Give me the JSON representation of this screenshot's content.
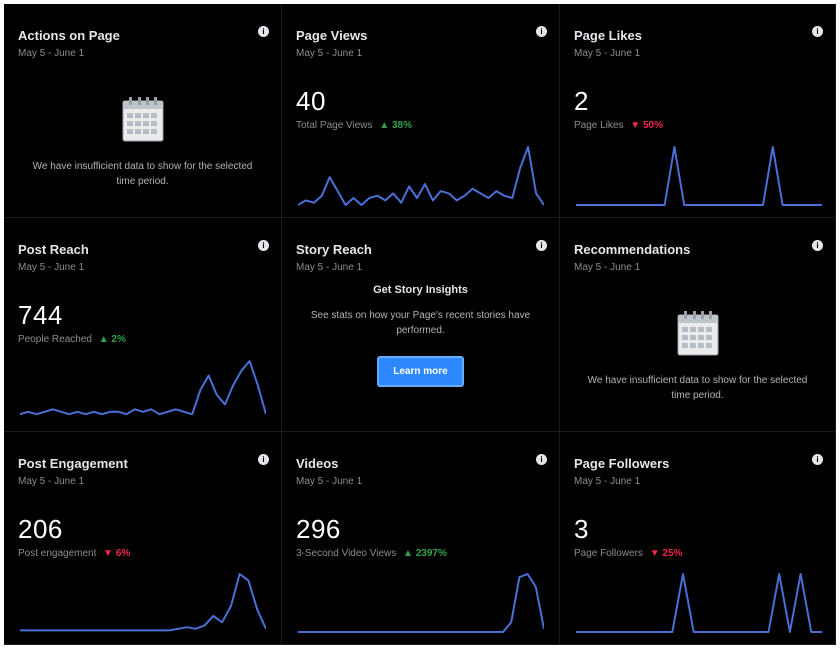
{
  "date_range": "May 5 - June 1",
  "colors": {
    "background": "#000000",
    "line": "#4b6fd6",
    "up": "#31a24c",
    "down": "#f02849",
    "button": "#2d88ff"
  },
  "info_icon": "info-circle-icon",
  "empty_message": "We have insufficient data to show for the selected time period.",
  "cards": {
    "actions_on_page": {
      "title": "Actions on Page",
      "date": "May 5 - June 1"
    },
    "page_views": {
      "title": "Page Views",
      "date": "May 5 - June 1",
      "value": "40",
      "metric_label": "Total Page Views",
      "change": "▲ 38%",
      "trend": "up",
      "series": [
        0,
        2,
        1,
        4,
        12,
        6,
        0,
        3,
        0,
        3,
        4,
        2,
        5,
        1,
        8,
        3,
        9,
        2,
        6,
        5,
        2,
        4,
        7,
        5,
        3,
        6,
        4,
        3,
        16,
        25,
        5,
        0
      ]
    },
    "page_likes": {
      "title": "Page Likes",
      "date": "May 5 - June 1",
      "value": "2",
      "metric_label": "Page Likes",
      "change": "▼ 50%",
      "trend": "down",
      "series": [
        0,
        0,
        0,
        0,
        0,
        0,
        0,
        0,
        0,
        0,
        1,
        0,
        0,
        0,
        0,
        0,
        0,
        0,
        0,
        0,
        1,
        0,
        0,
        0,
        0,
        0
      ]
    },
    "post_reach": {
      "title": "Post Reach",
      "date": "May 5 - June 1",
      "value": "744",
      "metric_label": "People Reached",
      "change": "▲ 2%",
      "trend": "up",
      "series": [
        2,
        3,
        2,
        3,
        4,
        3,
        2,
        3,
        2,
        3,
        2,
        3,
        3,
        2,
        4,
        3,
        4,
        2,
        3,
        4,
        3,
        2,
        12,
        18,
        10,
        6,
        14,
        20,
        24,
        14,
        2
      ]
    },
    "story_reach": {
      "title": "Story Reach",
      "date": "May 5 - June 1",
      "heading": "Get Story Insights",
      "description": "See stats on how your Page's recent stories have performed.",
      "button": "Learn more"
    },
    "recommendations": {
      "title": "Recommendations",
      "date": "May 5 - June 1"
    },
    "post_engagement": {
      "title": "Post Engagement",
      "date": "May 5 - June 1",
      "value": "206",
      "metric_label": "Post engagement",
      "change": "▼ 6%",
      "trend": "down",
      "series": [
        1,
        1,
        1,
        1,
        1,
        1,
        1,
        1,
        1,
        1,
        1,
        1,
        1,
        1,
        1,
        1,
        1,
        1,
        2,
        3,
        2,
        4,
        10,
        6,
        16,
        36,
        32,
        14,
        2
      ]
    },
    "videos": {
      "title": "Videos",
      "date": "May 5 - June 1",
      "value": "296",
      "metric_label": "3-Second Video Views",
      "change": "▲ 2397%",
      "trend": "up",
      "series": [
        0,
        0,
        0,
        0,
        0,
        0,
        0,
        0,
        0,
        0,
        0,
        0,
        0,
        0,
        0,
        0,
        0,
        0,
        0,
        0,
        0,
        0,
        0,
        0,
        0,
        0,
        6,
        34,
        36,
        28,
        2
      ]
    },
    "page_followers": {
      "title": "Page Followers",
      "date": "May 5 - June 1",
      "value": "3",
      "metric_label": "Page Followers",
      "change": "▼ 25%",
      "trend": "down",
      "series": [
        0,
        0,
        0,
        0,
        0,
        0,
        0,
        0,
        0,
        0,
        1,
        0,
        0,
        0,
        0,
        0,
        0,
        0,
        0,
        1,
        0,
        1,
        0,
        0
      ]
    }
  }
}
